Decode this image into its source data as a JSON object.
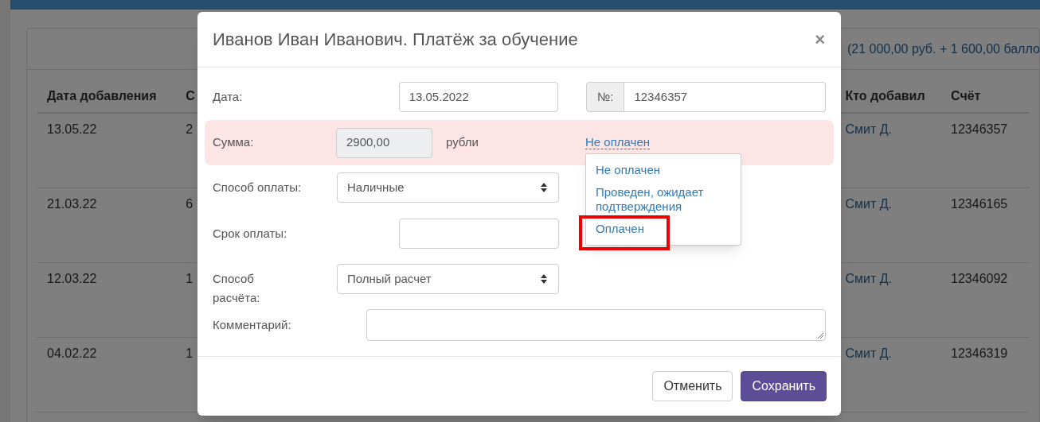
{
  "background_page": {
    "summary_total": "(21 000,00 руб. + 1 600,00 балло",
    "table": {
      "columns": [
        "Дата добавления",
        "С",
        "Кто добавил",
        "Счёт"
      ],
      "rows": [
        {
          "date": "13.05.22",
          "column_2": "2",
          "added_by": "Смит Д.",
          "invoice": "12346357"
        },
        {
          "date": "21.03.22",
          "column_2": "6",
          "added_by": "Смит Д.",
          "invoice": "12346165"
        },
        {
          "date": "12.03.22",
          "column_2": "1",
          "added_by": "Смит Д.",
          "invoice": "12346092"
        },
        {
          "date": "04.02.22",
          "column_2": "1",
          "added_by": "Смит Д.",
          "invoice": "12346319"
        }
      ]
    }
  },
  "dialog": {
    "title": "Иванов Иван Иванович. Платёж за обучение",
    "close": "×",
    "date": {
      "label": "Дата:",
      "value": "13.05.2022"
    },
    "number": {
      "addon": "№:",
      "value": "12346357"
    },
    "amount": {
      "label": "Сумма:",
      "value": "2900,00",
      "unit": "рубли",
      "status_link": "Не оплачен",
      "status_menu": [
        {
          "label": "Не оплачен",
          "highlighted": false
        },
        {
          "label": "Проведен, ожидает подтверждения",
          "highlighted": false
        },
        {
          "label": "Оплачен",
          "highlighted": true
        }
      ]
    },
    "payment_method": {
      "label": "Способ оплаты:",
      "value": "Наличные"
    },
    "due_date": {
      "label": "Срок оплаты:"
    },
    "settlement": {
      "label": "Способ расчёта:",
      "value": "Полный расчет"
    },
    "comment": {
      "label": "Комментарий:"
    },
    "buttons": [
      {
        "label": "Отменить",
        "kind": "secondary"
      },
      {
        "label": "Сохранить",
        "kind": "primary"
      }
    ]
  }
}
